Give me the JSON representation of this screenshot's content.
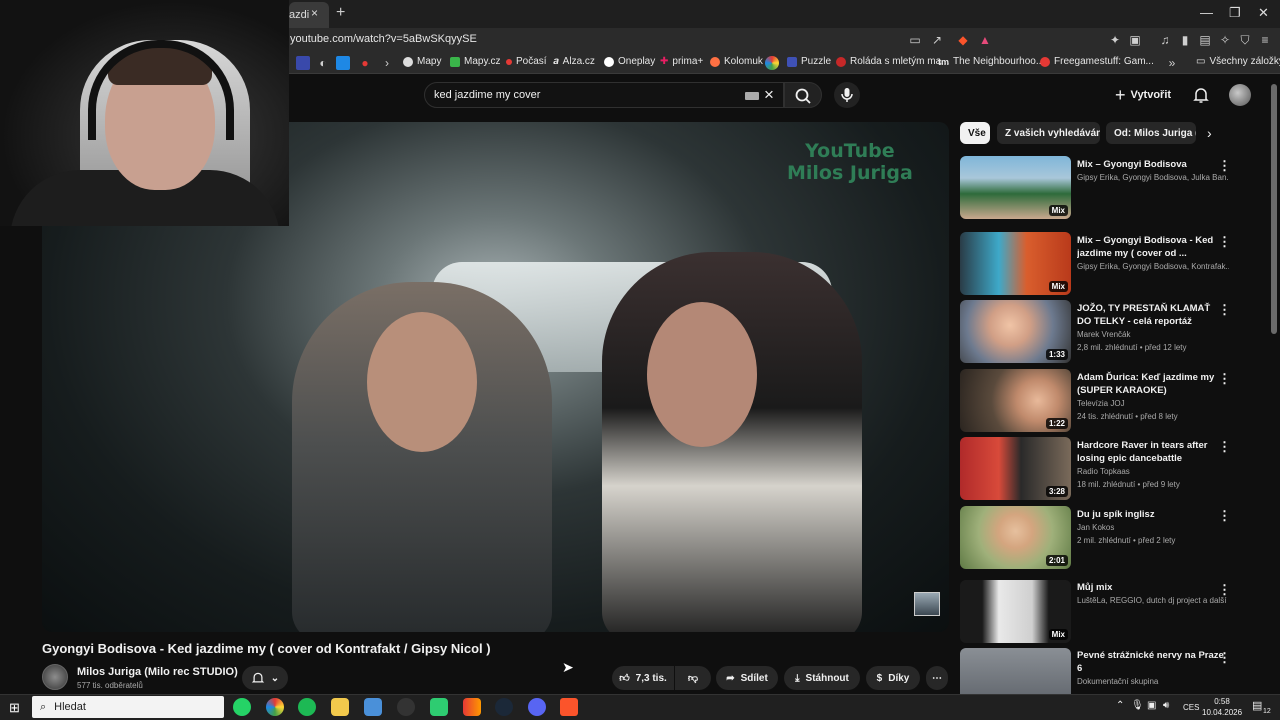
{
  "browser": {
    "tab_title": "azdi",
    "tab_close": "×",
    "new_tab": "+",
    "url": "youtube.com/watch?v=5aBwSKqyySE",
    "window": {
      "minimize": "—",
      "restore": "❐",
      "close": "✕"
    },
    "bookmarks": [
      {
        "label": "Mapy",
        "color": "#e0e0e0"
      },
      {
        "label": "Mapy.cz",
        "color": "#3ab54a"
      },
      {
        "label": "Počasí",
        "color": "#e53935"
      },
      {
        "label": "Alza.cz",
        "color": "#ffffff"
      },
      {
        "label": "Oneplay",
        "color": "#ffffff"
      },
      {
        "label": "prima+",
        "color": "#e91e63"
      },
      {
        "label": "Kolomuk",
        "color": "#ff7043"
      },
      {
        "label": "Puzzle",
        "color": "#3f51b5"
      },
      {
        "label": "Roláda s mletým ma...",
        "color": "#c62828"
      },
      {
        "label": "The Neighbourhoo...",
        "color": "#ffffff"
      },
      {
        "label": "Freegamestuff: Gam...",
        "color": "#e53935"
      },
      {
        "label": "Všechny záložky",
        "color": "#cfcfcf"
      }
    ]
  },
  "youtube": {
    "search_value": "ked jazdime my cover",
    "create_label": "Vytvořit",
    "video_watermark_line1": "YouTube",
    "video_watermark_line2": "Milos Juriga",
    "video_title": "Gyongyi Bodisova - Ked jazdime my ( cover od Kontrafakt / Gipsy Nicol )",
    "channel_name": "Milos Juriga (Milo rec STUDIO)",
    "channel_subs": "577 tis. odběratelů",
    "like_count": "7,3 tis.",
    "share_label": "Sdílet",
    "download_label": "Stáhnout",
    "thanks_label": "Díky",
    "chips": [
      "Vše",
      "Z vašich vyhledávání",
      "Od: Milos Juriga (M"
    ],
    "recommendations": [
      {
        "title": "Mix – Gyongyi Bodisova",
        "channel": "Gipsy Erika, Gyongyi Bodisova, Julka Ban...",
        "meta": "",
        "badge": "Mix"
      },
      {
        "title": "Mix – Gyongyi Bodisova - Ked jazdime my ( cover od ...",
        "channel": "Gipsy Erika, Gyongyi Bodisova, Kontrafak...",
        "meta": "",
        "badge": "Mix"
      },
      {
        "title": "JOŽO, TY PRESTAŇ KLAMAŤ DO TELKY - celá reportáž",
        "channel": "Marek Vrenčák",
        "meta": "2,8 mil. zhlédnutí • před 12 lety",
        "badge": "1:33"
      },
      {
        "title": "Adam Ďurica: Keď jazdime my (SUPER KARAOKE)",
        "channel": "Televízia JOJ",
        "meta": "24 tis. zhlédnutí • před 8 lety",
        "badge": "1:22"
      },
      {
        "title": "Hardcore Raver in tears after losing epic dancebattle",
        "channel": "Radio Topkaas",
        "meta": "18 mil. zhlédnutí • před 9 lety",
        "badge": "3:28"
      },
      {
        "title": "Du ju spík inglisz",
        "channel": "Jan Kokos",
        "meta": "2 mil. zhlédnutí • před 2 lety",
        "badge": "2:01"
      },
      {
        "title": "Můj mix",
        "channel": "LuštěLa, REGGIO, dutch dj project a další",
        "meta": "",
        "badge": "Mix"
      },
      {
        "title": "Pevné strážnické nervy na Praze 6",
        "channel": "Dokumentační skupina",
        "meta": "",
        "badge": ""
      }
    ]
  },
  "taskbar": {
    "search_placeholder": "Hledat",
    "language": "CES",
    "time": "0:58",
    "date": "10.04.2026",
    "notifications": "12"
  }
}
